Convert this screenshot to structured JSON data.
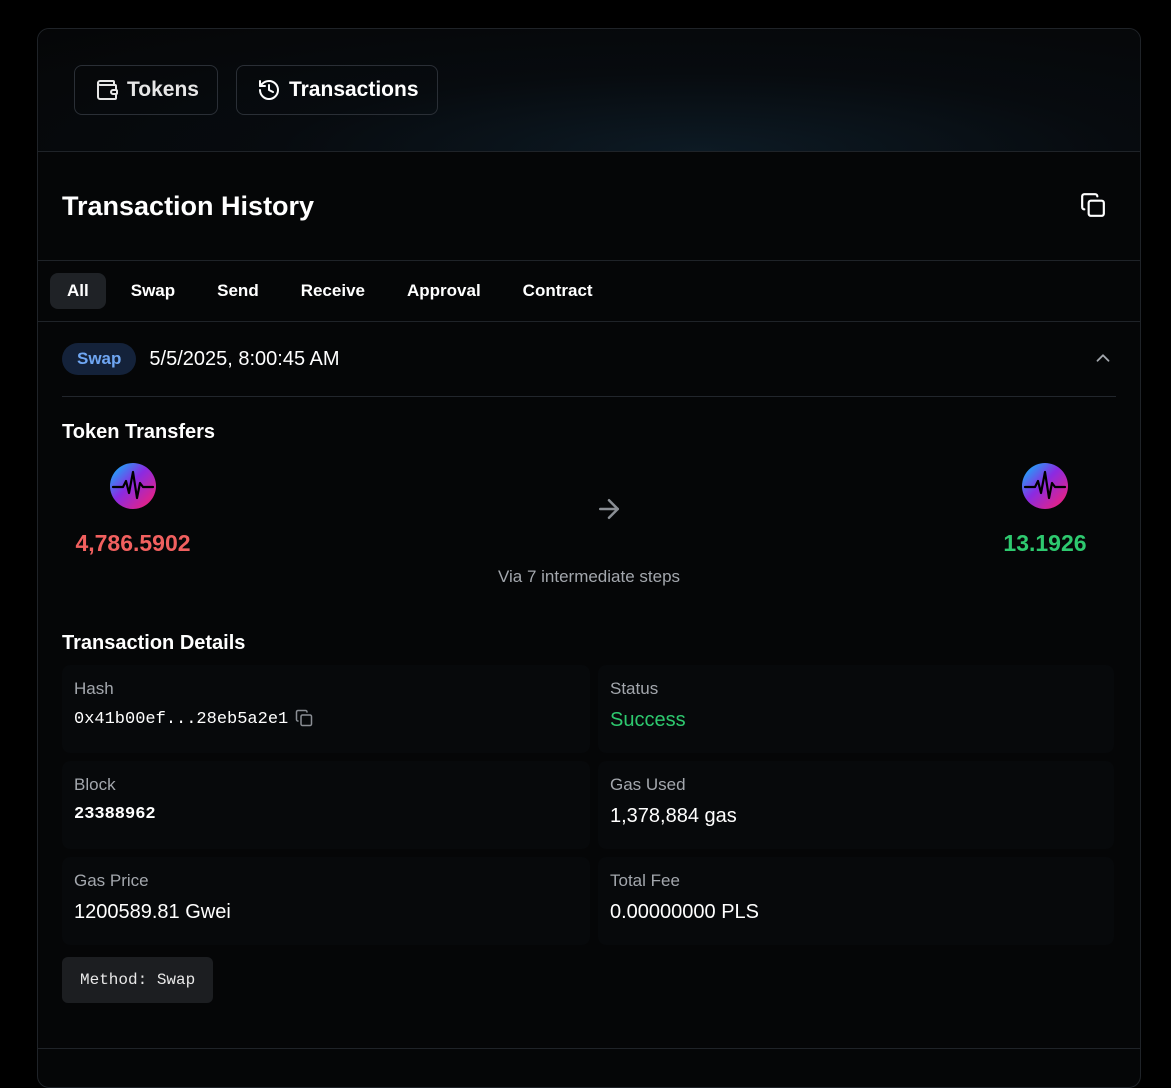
{
  "nav": {
    "tokens_label": "Tokens",
    "transactions_label": "Transactions"
  },
  "header": {
    "title": "Transaction History"
  },
  "filters": [
    "All",
    "Swap",
    "Send",
    "Receive",
    "Approval",
    "Contract"
  ],
  "active_filter": "All",
  "transaction": {
    "type_badge": "Swap",
    "datetime": "5/5/2025, 8:00:45 AM",
    "token_transfers_title": "Token Transfers",
    "from_amount": "4,786.5902",
    "to_amount": "13.1926",
    "via_text": "Via 7 intermediate steps",
    "details_title": "Transaction Details",
    "details": {
      "hash_label": "Hash",
      "hash_value": "0x41b00ef...28eb5a2e1",
      "status_label": "Status",
      "status_value": "Success",
      "block_label": "Block",
      "block_value": "23388962",
      "gas_used_label": "Gas Used",
      "gas_used_value": "1,378,884 gas",
      "gas_price_label": "Gas Price",
      "gas_price_value": "1200589.81 Gwei",
      "total_fee_label": "Total Fee",
      "total_fee_value": "0.00000000 PLS"
    },
    "method_text": "Method: Swap"
  },
  "colors": {
    "negative": "#f1605f",
    "positive": "#2ec96f",
    "badge_bg": "#14223a",
    "badge_text": "#6fa6f2"
  },
  "icons": {
    "tokens": "wallet-icon",
    "transactions": "history-icon",
    "copy": "copy-icon",
    "collapse": "chevron-up-icon",
    "arrow": "arrow-right-icon",
    "token_logo": "pulse-logo-icon"
  }
}
